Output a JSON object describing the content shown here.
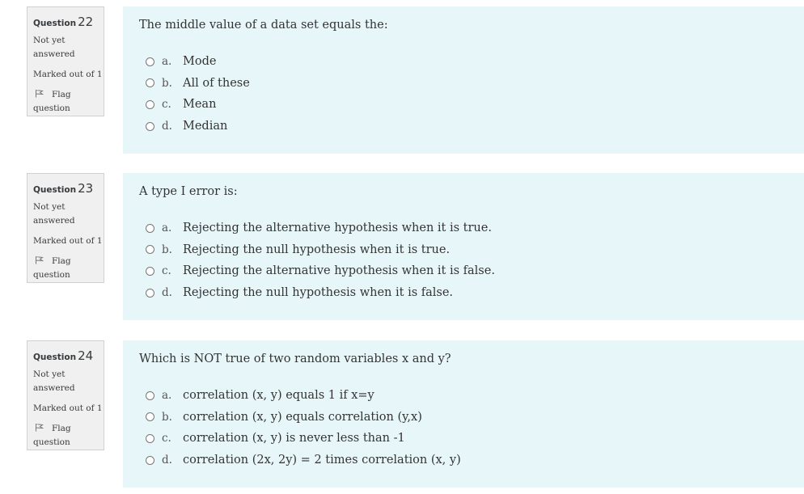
{
  "questions": [
    {
      "label": "Question",
      "number": "22",
      "state": "Not yet answered",
      "grade": "Marked out of 1",
      "flag_label": "Flag question",
      "text": "The middle value of a data set equals the:",
      "answers": [
        {
          "letter": "a.",
          "text": "Mode"
        },
        {
          "letter": "b.",
          "text": "All of these"
        },
        {
          "letter": "c.",
          "text": "Mean"
        },
        {
          "letter": "d.",
          "text": "Median"
        }
      ]
    },
    {
      "label": "Question",
      "number": "23",
      "state": "Not yet answered",
      "grade": "Marked out of 1",
      "flag_label": "Flag question",
      "text": "A type I error is:",
      "answers": [
        {
          "letter": "a.",
          "text": "Rejecting the alternative hypothesis when it is true."
        },
        {
          "letter": "b.",
          "text": "Rejecting the null hypothesis when it is true."
        },
        {
          "letter": "c.",
          "text": "Rejecting the alternative hypothesis when it is false."
        },
        {
          "letter": "d.",
          "text": "Rejecting the null hypothesis when it is false."
        }
      ]
    },
    {
      "label": "Question",
      "number": "24",
      "state": "Not yet answered",
      "grade": "Marked out of 1",
      "flag_label": "Flag question",
      "text": "Which is NOT true of two random variables x and y?",
      "answers": [
        {
          "letter": "a.",
          "text": "correlation (x, y) equals 1 if x=y"
        },
        {
          "letter": "b.",
          "text": "correlation (x, y) equals correlation (y,x)"
        },
        {
          "letter": "c.",
          "text": "correlation (x, y) is never less than -1"
        },
        {
          "letter": "d.",
          "text": "correlation (2x, 2y) = 2 times correlation (x, y)"
        }
      ]
    }
  ],
  "icons": {
    "flag": "flag-outline-icon",
    "radio": "radio-unchecked-icon"
  }
}
